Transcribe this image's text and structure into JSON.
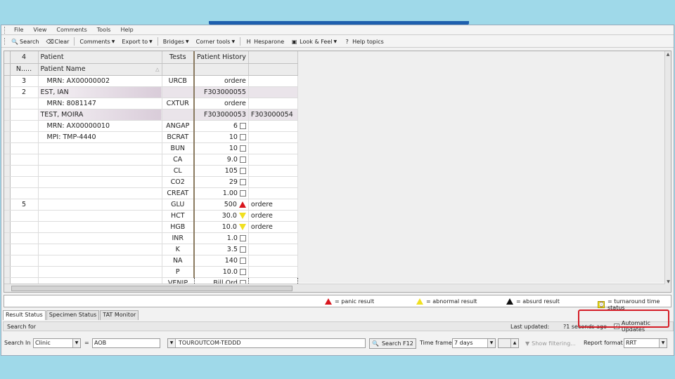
{
  "menu": [
    "File",
    "View",
    "Comments",
    "Tools",
    "Help"
  ],
  "toolbar": [
    {
      "icon": "search-icon",
      "label": "Search"
    },
    {
      "icon": "clear-icon",
      "label": "Clear"
    },
    {
      "icon": "",
      "label": "Comments",
      "dropdown": true
    },
    {
      "icon": "",
      "label": "Export to",
      "dropdown": true
    },
    {
      "icon": "",
      "label": "Bridges",
      "dropdown": true
    },
    {
      "icon": "",
      "label": "Corner tools",
      "dropdown": true
    },
    {
      "icon": "h-icon",
      "label": "Hesparone"
    },
    {
      "icon": "look-feel-icon",
      "label": "Look & Feel",
      "dropdown": true
    },
    {
      "icon": "help-icon",
      "label": "Help topics"
    }
  ],
  "grid": {
    "header1": {
      "count": "4",
      "patient": "Patient",
      "tests": "Tests",
      "history": "Patient History"
    },
    "header2": {
      "n": "N.....",
      "patient_name": "Patient Name"
    },
    "rows": [
      {
        "n": "3",
        "patient": "MRN: AX00000002",
        "test": "URCB",
        "hist": "ordere",
        "hist2": "",
        "flag": "",
        "cb": false,
        "style": "sub"
      },
      {
        "n": "2",
        "patient": "EST, IAN",
        "test": "",
        "hist": "F303000055",
        "hist2": "",
        "flag": "",
        "cb": false,
        "style": "nm"
      },
      {
        "n": "",
        "patient": "MRN: 8081147",
        "test": "CXTUR",
        "hist": "ordere",
        "hist2": "",
        "flag": "",
        "cb": false,
        "style": "sub"
      },
      {
        "n": "",
        "patient": "TEST, MOIRA",
        "test": "",
        "hist": "F303000053",
        "hist2": "F303000054",
        "flag": "",
        "cb": false,
        "style": "nm"
      },
      {
        "n": "",
        "patient": "MRN: AX00000010",
        "test": "ANGAP",
        "hist": "6",
        "hist2": "",
        "flag": "",
        "cb": true,
        "style": "sub"
      },
      {
        "n": "",
        "patient": "MPI: TMP-4440",
        "test": "BCRAT",
        "hist": "10",
        "hist2": "",
        "flag": "",
        "cb": true,
        "style": "sub"
      },
      {
        "n": "",
        "patient": "",
        "test": "BUN",
        "hist": "10",
        "hist2": "",
        "flag": "",
        "cb": true,
        "style": ""
      },
      {
        "n": "",
        "patient": "",
        "test": "CA",
        "hist": "9.0",
        "hist2": "",
        "flag": "",
        "cb": true,
        "style": ""
      },
      {
        "n": "",
        "patient": "",
        "test": "CL",
        "hist": "105",
        "hist2": "",
        "flag": "",
        "cb": true,
        "style": ""
      },
      {
        "n": "",
        "patient": "",
        "test": "CO2",
        "hist": "29",
        "hist2": "",
        "flag": "",
        "cb": true,
        "style": ""
      },
      {
        "n": "",
        "patient": "",
        "test": "CREAT",
        "hist": "1.00",
        "hist2": "",
        "flag": "",
        "cb": true,
        "style": ""
      },
      {
        "n": "5",
        "patient": "",
        "test": "GLU",
        "hist": "500",
        "hist2": "ordere",
        "flag": "red",
        "cb": false,
        "style": ""
      },
      {
        "n": "",
        "patient": "",
        "test": "HCT",
        "hist": "30.0",
        "hist2": "ordere",
        "flag": "yel",
        "cb": false,
        "style": ""
      },
      {
        "n": "",
        "patient": "",
        "test": "HGB",
        "hist": "10.0",
        "hist2": "ordere",
        "flag": "yel",
        "cb": false,
        "style": ""
      },
      {
        "n": "",
        "patient": "",
        "test": "INR",
        "hist": "1.0",
        "hist2": "",
        "flag": "",
        "cb": true,
        "style": ""
      },
      {
        "n": "",
        "patient": "",
        "test": "K",
        "hist": "3.5",
        "hist2": "",
        "flag": "",
        "cb": true,
        "style": ""
      },
      {
        "n": "",
        "patient": "",
        "test": "NA",
        "hist": "140",
        "hist2": "",
        "flag": "",
        "cb": true,
        "style": ""
      },
      {
        "n": "",
        "patient": "",
        "test": "P",
        "hist": "10.0",
        "hist2": "",
        "flag": "",
        "cb": true,
        "style": ""
      },
      {
        "n": "",
        "patient": "",
        "test": "VENIP",
        "hist": "Bill Ord",
        "hist2": "",
        "flag": "",
        "cb": true,
        "style": "dotted"
      }
    ]
  },
  "legend": {
    "panic": "= panic result",
    "abnormal": "= abnormal result",
    "absurd": "= absurd result",
    "turnaround": "= turnaround time status"
  },
  "tabs": [
    "Result Status",
    "Specimen Status",
    "TAT Monitor"
  ],
  "search_bar": {
    "title": "Search for",
    "last_updated": "Last updated:",
    "seconds_ago": "?1 seconds ago",
    "auto_updates": "Automatic Updates"
  },
  "search_row": {
    "search_label": "Search In",
    "field1": "Clinic",
    "dash": "=",
    "field2": "AOB",
    "field3": "TOUROUTCOM-TEDDD",
    "search_button": "Search F12",
    "timeframe_label": "Time frame",
    "timeframe": "7 days",
    "filter_button": "Show filtering...",
    "report_label": "Report format",
    "report_value": "RRT"
  },
  "colors": {
    "panic": "#d8161e",
    "abnormal": "#f0e020",
    "highlight_box": "#d51d26"
  }
}
